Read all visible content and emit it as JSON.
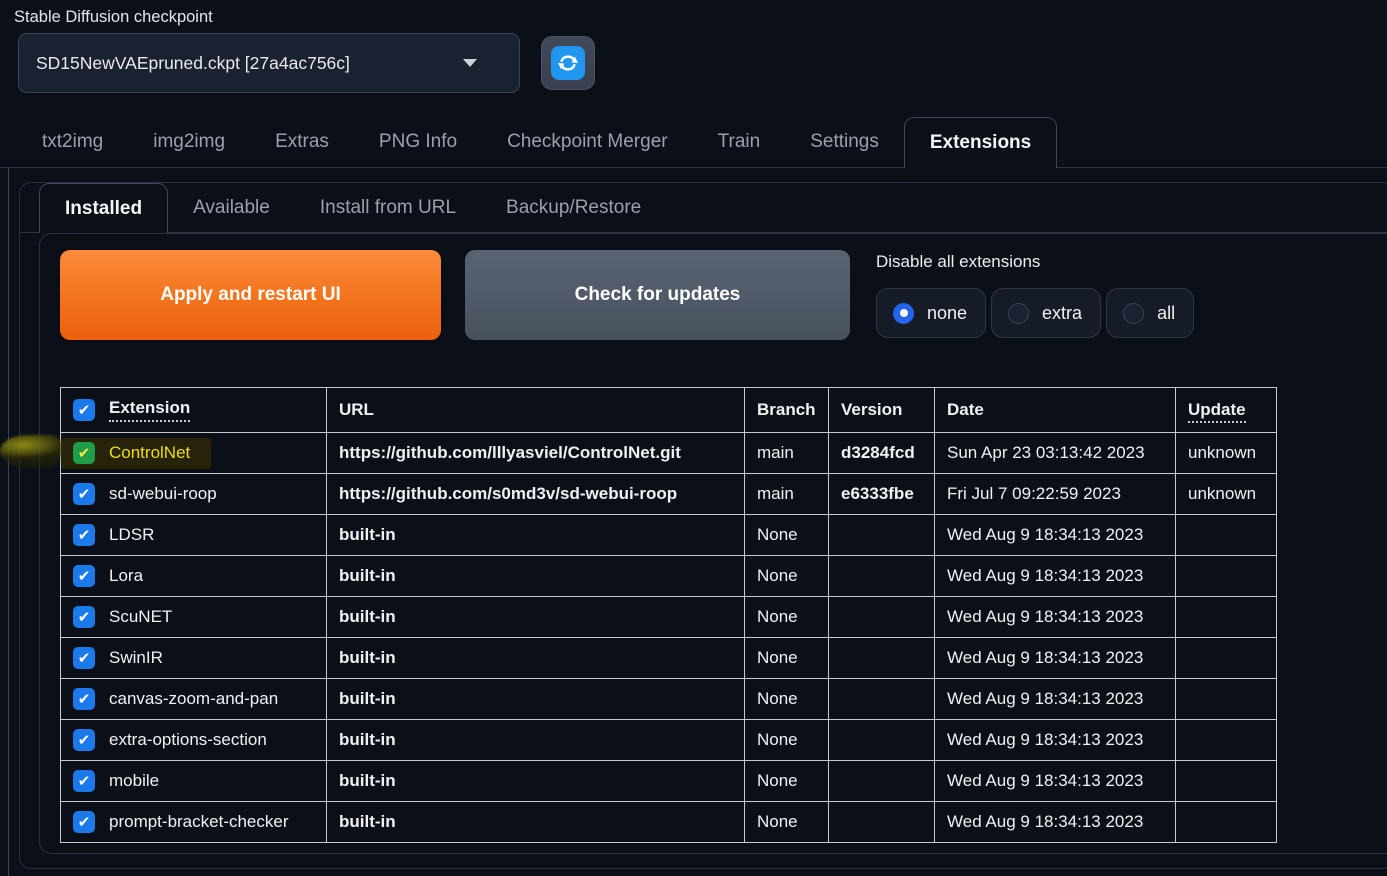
{
  "header": {
    "checkpoint_label": "Stable Diffusion checkpoint",
    "checkpoint_value": "SD15NewVAEpruned.ckpt [27a4ac756c]"
  },
  "main_tabs": [
    "txt2img",
    "img2img",
    "Extras",
    "PNG Info",
    "Checkpoint Merger",
    "Train",
    "Settings",
    "Extensions"
  ],
  "main_tabs_active": "Extensions",
  "sub_tabs": [
    "Installed",
    "Available",
    "Install from URL",
    "Backup/Restore"
  ],
  "sub_tabs_active": "Installed",
  "toolbar": {
    "apply_label": "Apply and restart UI",
    "check_updates_label": "Check for updates",
    "disable_all_label": "Disable all extensions",
    "disable_options": [
      "none",
      "extra",
      "all"
    ],
    "disable_selected": "none"
  },
  "table": {
    "headers": {
      "extension": "Extension",
      "url": "URL",
      "branch": "Branch",
      "version": "Version",
      "date": "Date",
      "update": "Update"
    },
    "rows": [
      {
        "name": "ControlNet",
        "url": "https://github.com/lllyasviel/ControlNet.git",
        "branch": "main",
        "version": "d3284fcd",
        "date": "Sun Apr 23 03:13:42 2023",
        "update": "unknown",
        "checked": true,
        "highlighted": true
      },
      {
        "name": "sd-webui-roop",
        "url": "https://github.com/s0md3v/sd-webui-roop",
        "branch": "main",
        "version": "e6333fbe",
        "date": "Fri Jul 7 09:22:59 2023",
        "update": "unknown",
        "checked": true,
        "highlighted": false
      },
      {
        "name": "LDSR",
        "url": "built-in",
        "branch": "None",
        "version": "",
        "date": "Wed Aug 9 18:34:13 2023",
        "update": "",
        "checked": true,
        "highlighted": false
      },
      {
        "name": "Lora",
        "url": "built-in",
        "branch": "None",
        "version": "",
        "date": "Wed Aug 9 18:34:13 2023",
        "update": "",
        "checked": true,
        "highlighted": false
      },
      {
        "name": "ScuNET",
        "url": "built-in",
        "branch": "None",
        "version": "",
        "date": "Wed Aug 9 18:34:13 2023",
        "update": "",
        "checked": true,
        "highlighted": false
      },
      {
        "name": "SwinIR",
        "url": "built-in",
        "branch": "None",
        "version": "",
        "date": "Wed Aug 9 18:34:13 2023",
        "update": "",
        "checked": true,
        "highlighted": false
      },
      {
        "name": "canvas-zoom-and-pan",
        "url": "built-in",
        "branch": "None",
        "version": "",
        "date": "Wed Aug 9 18:34:13 2023",
        "update": "",
        "checked": true,
        "highlighted": false
      },
      {
        "name": "extra-options-section",
        "url": "built-in",
        "branch": "None",
        "version": "",
        "date": "Wed Aug 9 18:34:13 2023",
        "update": "",
        "checked": true,
        "highlighted": false
      },
      {
        "name": "mobile",
        "url": "built-in",
        "branch": "None",
        "version": "",
        "date": "Wed Aug 9 18:34:13 2023",
        "update": "",
        "checked": true,
        "highlighted": false
      },
      {
        "name": "prompt-bracket-checker",
        "url": "built-in",
        "branch": "None",
        "version": "",
        "date": "Wed Aug 9 18:34:13 2023",
        "update": "",
        "checked": true,
        "highlighted": false
      }
    ]
  },
  "icons": {
    "check": "✔"
  },
  "colors": {
    "background": "#0b0f17",
    "accent_orange": "#f3731b",
    "button_gray": "#4f5866",
    "checkbox_blue": "#1b79ea",
    "radio_selected_blue": "#2563eb",
    "highlight_yellow_text": "#ecdf0c",
    "highlight_checkbox_green": "#1f9d49",
    "refresh_icon_blue": "#2196f0",
    "table_border": "#c6cad0"
  }
}
